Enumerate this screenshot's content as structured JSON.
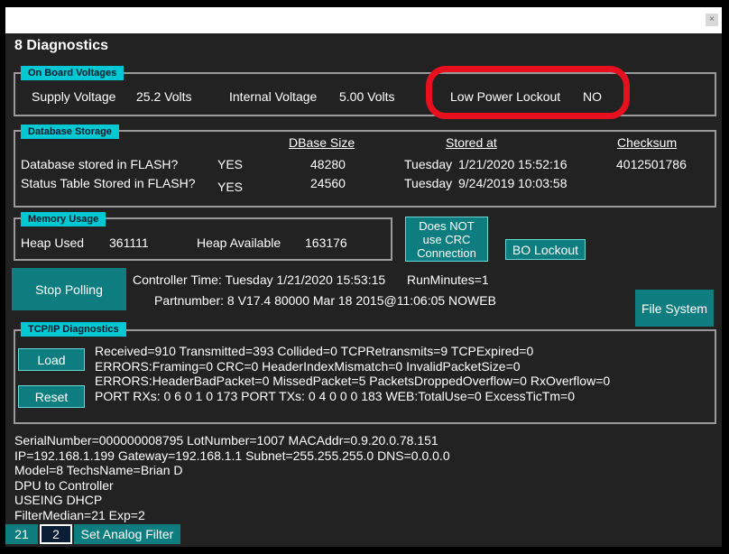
{
  "window": {
    "close_glyph": "×"
  },
  "title": "8 Diagnostics",
  "onboard": {
    "label": "On Board Voltages",
    "supply_label": "Supply Voltage",
    "supply_value": "25.2 Volts",
    "internal_label": "Internal Voltage",
    "internal_value": "5.00 Volts",
    "lockout_label": "Low Power Lockout",
    "lockout_value": "NO"
  },
  "database": {
    "label": "Database Storage",
    "headers": {
      "size": "DBase Size",
      "stored": "Stored at",
      "checksum": "Checksum"
    },
    "rows": [
      {
        "label": "Database stored in FLASH?",
        "flag": "YES",
        "size": "48280",
        "day": "Tuesday",
        "date": "1/21/2020",
        "time": "15:52:16",
        "checksum": "4012501786"
      },
      {
        "label": "Status Table Stored in FLASH?",
        "flag": "YES",
        "size": "24560",
        "day": "Tuesday",
        "date": "9/24/2019",
        "time": "10:03:58",
        "checksum": ""
      }
    ]
  },
  "memory": {
    "label": "Memory Usage",
    "heap_used_label": "Heap Used",
    "heap_used_value": "361111",
    "heap_avail_label": "Heap Available",
    "heap_avail_value": "163176"
  },
  "crc_button": "Does NOT use CRC Connection",
  "bo_lockout_button": "BO Lockout",
  "stop_polling_button": "Stop Polling",
  "controller_time": "Controller Time:  Tuesday  1/21/2020  15:53:15",
  "run_minutes": "RunMinutes=1",
  "partnumber": "Partnumber:  8 V17.4  80000  Mar 18 2015@11:06:05 NOWEB",
  "file_system_button": "File System",
  "tcp": {
    "label": "TCP/IP Diagnostics",
    "load_button": "Load",
    "reset_button": "Reset",
    "lines": [
      "Received=910 Transmitted=393 Collided=0 TCPRetransmits=9 TCPExpired=0",
      "ERRORS:Framing=0 CRC=0 HeaderIndexMismatch=0 InvalidPacketSize=0",
      "ERRORS:HeaderBadPacket=0 MissedPacket=5 PacketsDroppedOverflow=0 RxOverflow=0",
      "PORT RXs: 0 6 0 1 0 173  PORT TXs: 0 4 0 0 0 183  WEB:TotalUse=0 ExcessTicTm=0"
    ]
  },
  "info_lines": [
    "SerialNumber=000000008795 LotNumber=1007 MACAddr=0.9.20.0.78.151",
    "IP=192.168.1.199 Gateway=192.168.1.1 Subnet=255.255.255.0 DNS=0.0.0.0",
    "Model=8 TechsName=Brian D",
    "DPU to Controller",
    "USEING DHCP",
    "FilterMedian=21 Exp=2"
  ],
  "filter": {
    "median_value": "21",
    "exp_value": "2",
    "set_button": "Set Analog Filter"
  },
  "colors": {
    "background": "#222222",
    "accent": "#00c8d2",
    "button": "#0e7d80",
    "highlight": "#e8101e"
  }
}
